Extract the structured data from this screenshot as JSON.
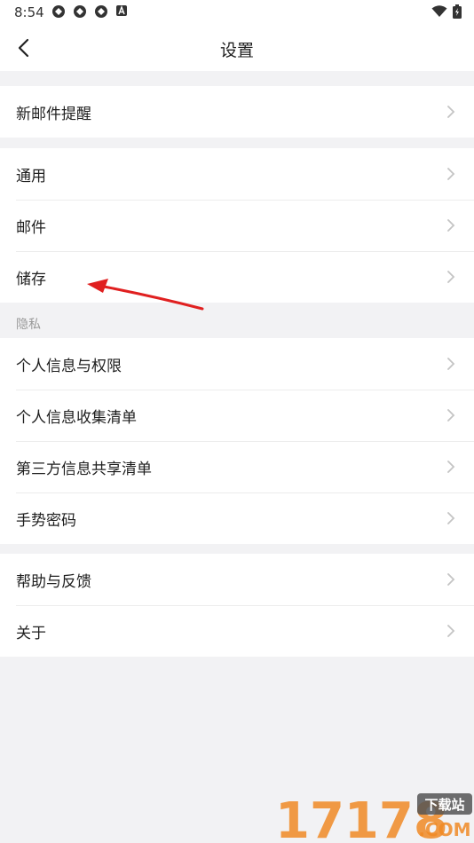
{
  "status_bar": {
    "time": "8:54"
  },
  "header": {
    "title": "设置"
  },
  "groups": {
    "notify": [
      "新邮件提醒"
    ],
    "general": [
      "通用",
      "邮件",
      "储存"
    ],
    "privacy_label": "隐私",
    "privacy": [
      "个人信息与权限",
      "个人信息收集清单",
      "第三方信息共享清单",
      "手势密码"
    ],
    "about": [
      "帮助与反馈",
      "关于"
    ]
  },
  "watermark": {
    "number": "17178",
    "text1": "下载站",
    "text2": ".COM"
  },
  "colors": {
    "annotation_arrow": "#e02020",
    "watermark_orange": "#f08a24"
  }
}
